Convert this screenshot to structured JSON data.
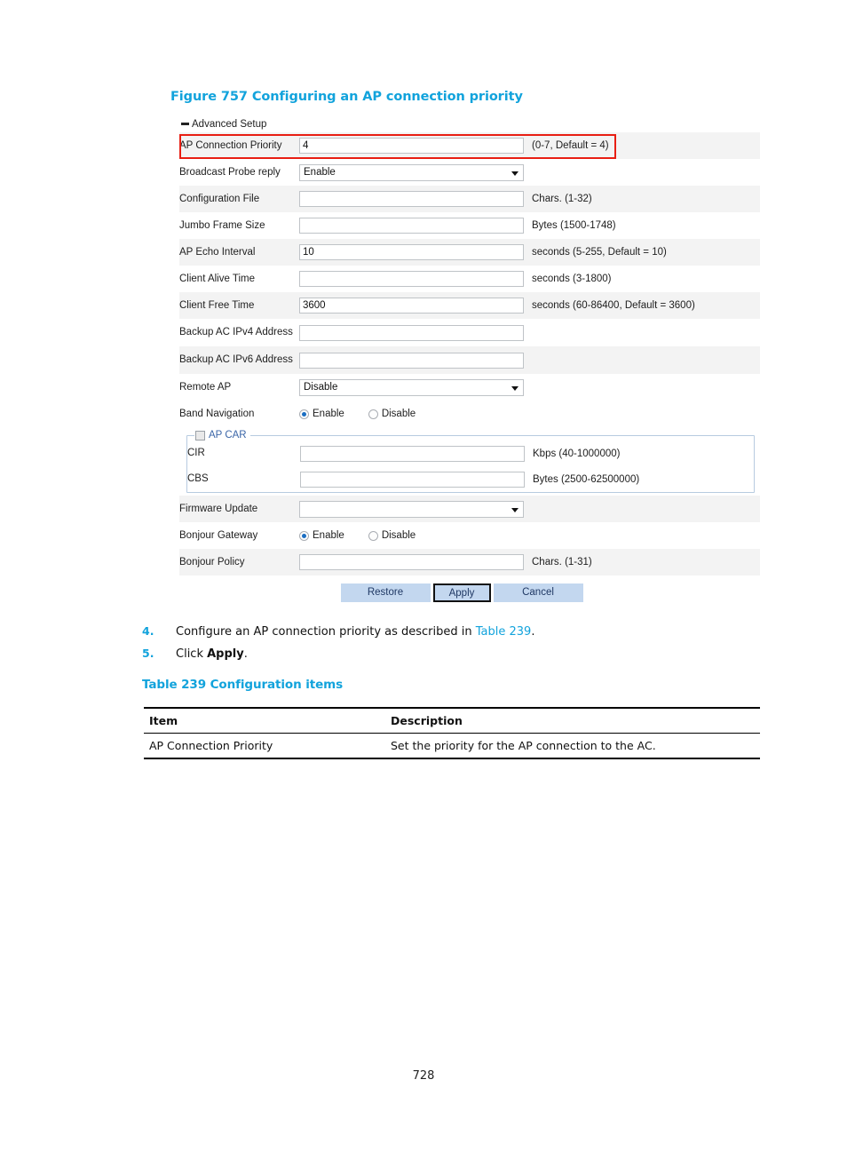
{
  "figure": {
    "caption": "Figure 757 Configuring an AP connection priority"
  },
  "form": {
    "section_title": "Advanced Setup",
    "rows": [
      {
        "label": "AP Connection Priority",
        "type": "text",
        "value": "4",
        "hint": "(0-7, Default = 4)",
        "shaded": true,
        "highlight": true
      },
      {
        "label": "Broadcast Probe reply",
        "type": "select",
        "value": "Enable",
        "hint": "",
        "shaded": false
      },
      {
        "label": "Configuration File",
        "type": "text",
        "value": "",
        "hint": "Chars. (1-32)",
        "shaded": true
      },
      {
        "label": "Jumbo Frame Size",
        "type": "text",
        "value": "",
        "hint": "Bytes (1500-1748)",
        "shaded": false
      },
      {
        "label": "AP Echo Interval",
        "type": "text",
        "value": "10",
        "hint": "seconds (5-255, Default = 10)",
        "shaded": true
      },
      {
        "label": "Client Alive Time",
        "type": "text",
        "value": "",
        "hint": "seconds (3-1800)",
        "shaded": false
      },
      {
        "label": "Client Free Time",
        "type": "text",
        "value": "3600",
        "hint": "seconds (60-86400, Default = 3600)",
        "shaded": true
      },
      {
        "label": "Backup AC IPv4 Address",
        "type": "text",
        "value": "",
        "hint": "",
        "shaded": false
      },
      {
        "label": "Backup AC IPv6 Address",
        "type": "text",
        "value": "",
        "hint": "",
        "shaded": true
      },
      {
        "label": "Remote AP",
        "type": "select",
        "value": "Disable",
        "hint": "",
        "shaded": false
      },
      {
        "label": "Band Navigation",
        "type": "radio",
        "value": "Enable",
        "hint": "",
        "shaded": false
      }
    ],
    "radio_options": {
      "enable": "Enable",
      "disable": "Disable"
    },
    "ap_car": {
      "legend": "AP CAR",
      "checked": false,
      "rows": [
        {
          "label": "CIR",
          "value": "",
          "hint": "Kbps (40-1000000)"
        },
        {
          "label": "CBS",
          "value": "",
          "hint": "Bytes (2500-62500000)"
        }
      ]
    },
    "rows_after": [
      {
        "label": "Firmware Update",
        "type": "select",
        "value": "",
        "hint": "",
        "shaded": true
      },
      {
        "label": "Bonjour Gateway",
        "type": "radio",
        "value": "Enable",
        "hint": "",
        "shaded": false
      },
      {
        "label": "Bonjour Policy",
        "type": "text",
        "value": "",
        "hint": "Chars. (1-31)",
        "shaded": true
      }
    ],
    "buttons": {
      "restore": "Restore",
      "apply": "Apply",
      "cancel": "Cancel"
    }
  },
  "steps": [
    {
      "num": "4.",
      "pre": "Configure an AP connection priority as described in ",
      "xref": "Table 239",
      "post": "."
    },
    {
      "num": "5.",
      "pre": "Click ",
      "bold": "Apply",
      "post": "."
    }
  ],
  "table": {
    "caption": "Table 239 Configuration items",
    "headers": [
      "Item",
      "Description"
    ],
    "rows": [
      [
        "AP Connection Priority",
        "Set the priority for the AP connection to the AC."
      ]
    ]
  },
  "page_number": "728",
  "colors": {
    "accent_blue": "#12a3dc",
    "highlight_red": "#e81e13",
    "button_blue": "#c3d7ef",
    "legend_blue": "#3b66a8",
    "row_shade": "#f3f3f3"
  }
}
